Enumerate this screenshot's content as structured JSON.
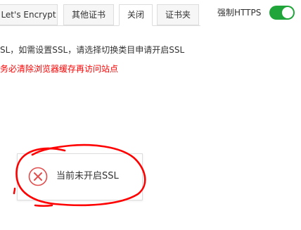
{
  "tabs": [
    {
      "label": "Let's Encrypt",
      "active": false
    },
    {
      "label": "其他证书",
      "active": false
    },
    {
      "label": "关闭",
      "active": true
    },
    {
      "label": "证书夹",
      "active": false
    }
  ],
  "force_https": {
    "label": "强制HTTPS",
    "enabled": true
  },
  "notes": {
    "info": "SL，如需设置SSL，请选择切换类目申请开启SSL",
    "warning": "务必清除浏览器缓存再访问站点"
  },
  "status": {
    "icon": "close-circle-icon",
    "text": "当前未开启SSL"
  },
  "colors": {
    "accent_green": "#20a53a",
    "warning_red": "#ff0000",
    "status_icon_red": "#e14e4e",
    "annotation_red": "#ff0000"
  }
}
